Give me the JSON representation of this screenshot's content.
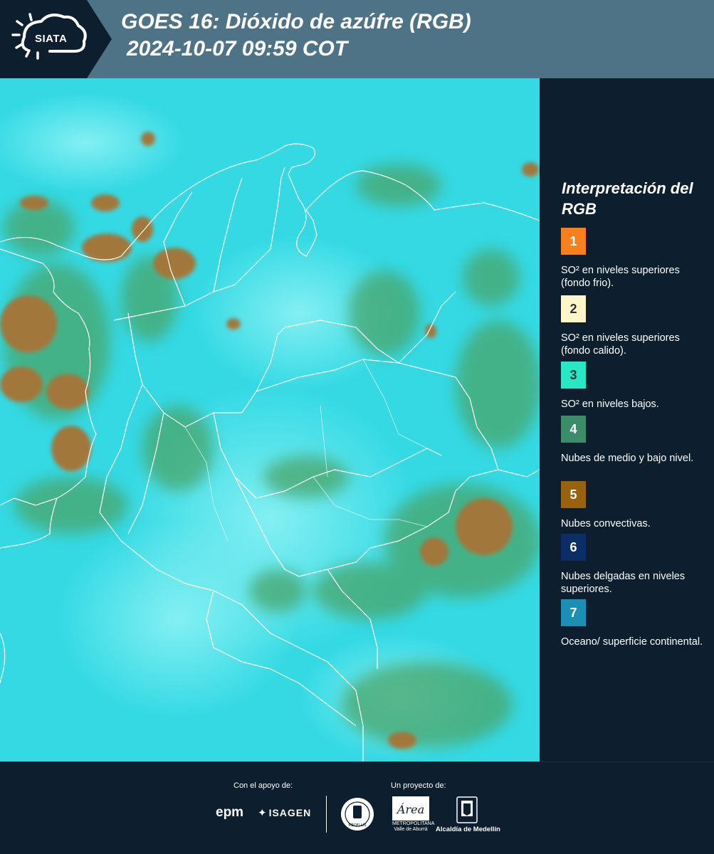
{
  "header": {
    "logo_text": "SIATA",
    "title_line1": "GOES 16: Dióxido de azúfre (RGB)",
    "title_line2": "2024-10-07 09:59 COT",
    "bg_color": "#4e7386"
  },
  "map": {
    "icon": "goes16-so2-rgb-satellite-map",
    "background_color": "#32d8e3",
    "border_color": "#ffffff"
  },
  "legend": {
    "title": "Interpretación del RGB",
    "items": [
      {
        "number": "1",
        "color": "#f7801c",
        "text_color": "#ffffff",
        "label": "SO² en niveles superiores (fondo frio)."
      },
      {
        "number": "2",
        "color": "#fdf6c8",
        "text_color": "#333333",
        "label": "SO² en niveles superiores (fondo calido)."
      },
      {
        "number": "3",
        "color": "#27e8c5",
        "text_color": "#333333",
        "label": "SO² en niveles bajos."
      },
      {
        "number": "4",
        "color": "#3a8d66",
        "text_color": "#ffffff",
        "label": "Nubes de medio y bajo nivel."
      },
      {
        "number": "5",
        "color": "#98620e",
        "text_color": "#ffffff",
        "label": "Nubes convectivas."
      },
      {
        "number": "6",
        "color": "#0c2e66",
        "text_color": "#ffffff",
        "label": "Nubes delgadas en niveles superiores."
      },
      {
        "number": "7",
        "color": "#1c8fb4",
        "text_color": "#ffffff",
        "label": "Oceano/ superficie continental."
      }
    ]
  },
  "footer": {
    "support_caption": "Con el apoyo de:",
    "project_caption": "Un proyecto de:",
    "epm_text": "epm",
    "isagen_text": "ISAGEN",
    "area_text": "METROPOLITANA Valle de Aburrá",
    "area_script": "Área",
    "alcaldia_text": "Alcaldía de Medellín",
    "medellin_seal_text": "MEDELLÍN"
  }
}
